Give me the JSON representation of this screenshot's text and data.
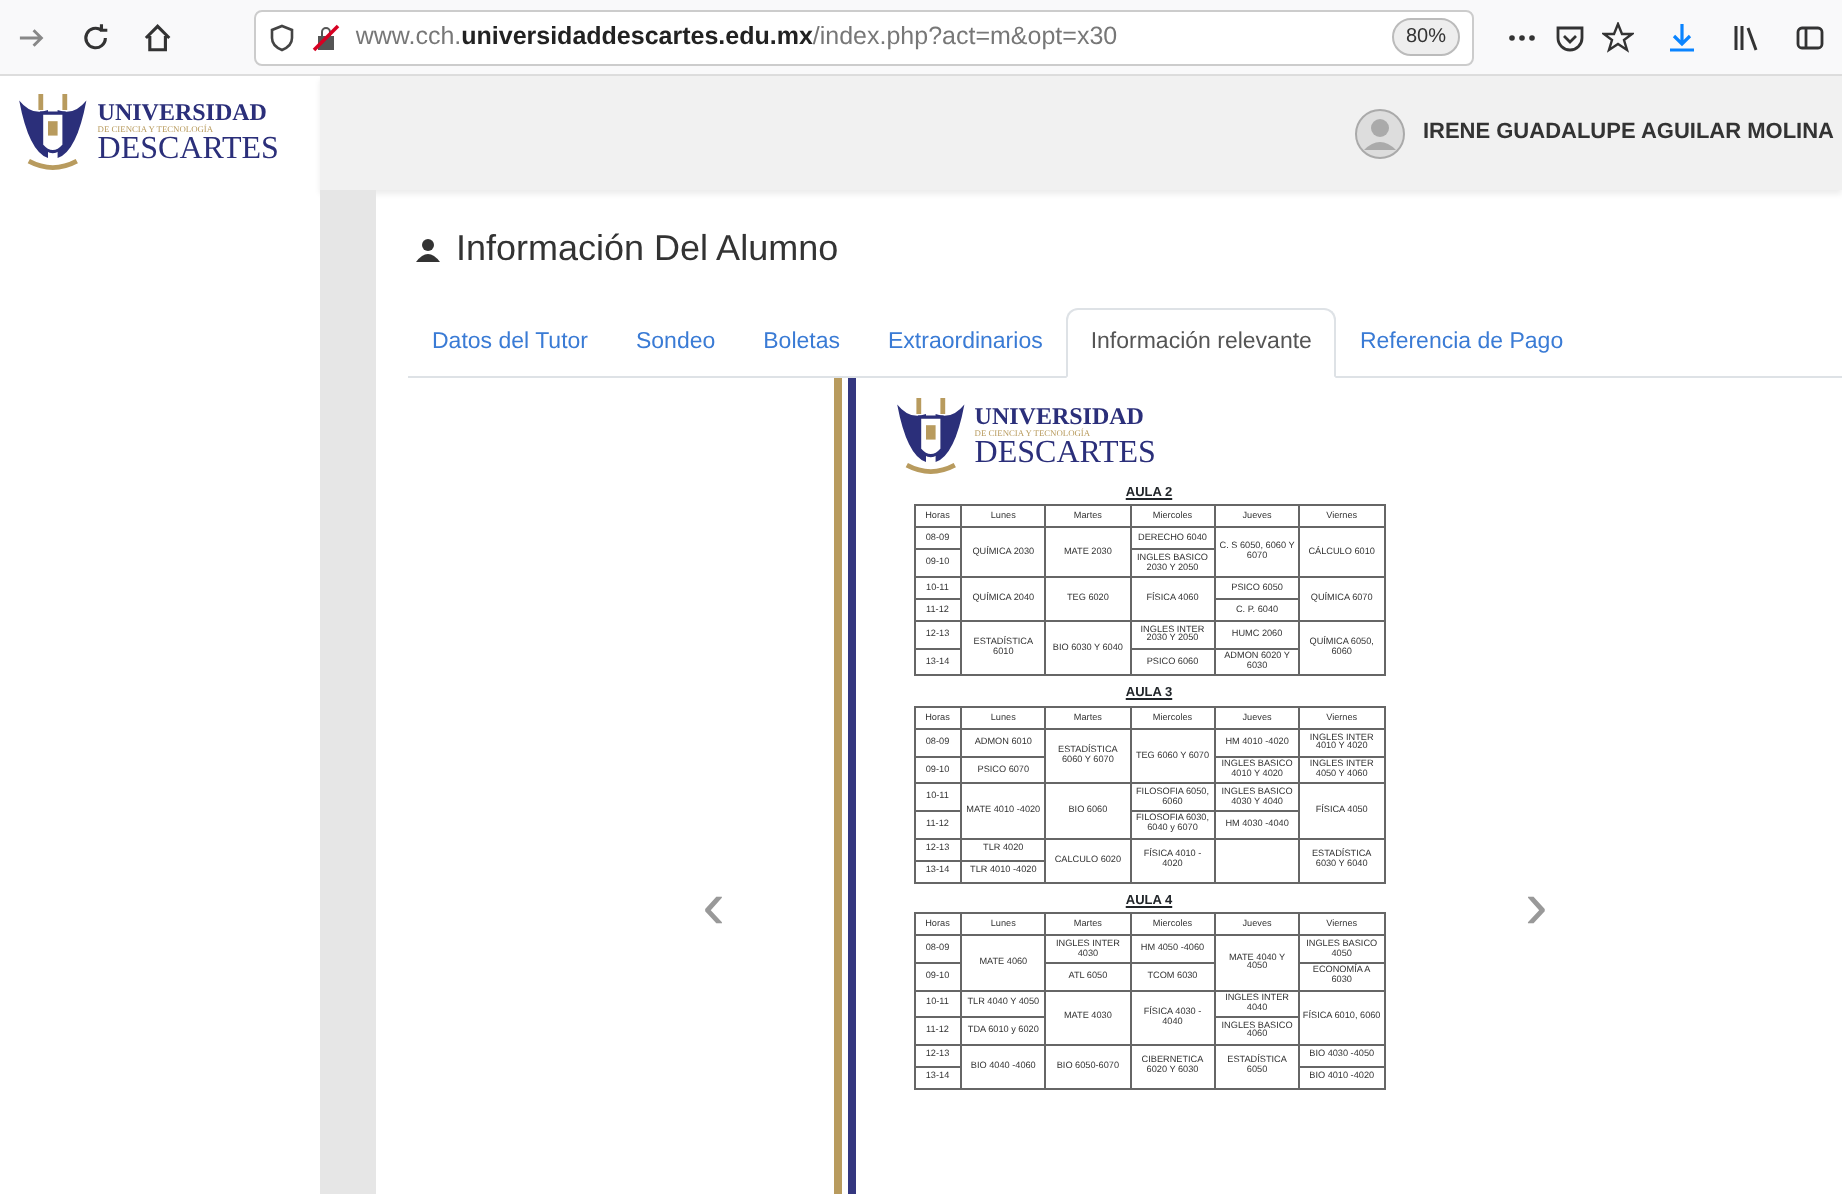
{
  "browser": {
    "url": "www.cch.**universidaddescartes.edu.mx**/index.php?act=m&opt=x30",
    "zoom": "80%"
  },
  "logo": {
    "line1": "UNIVERSIDAD",
    "line2": "DE CIENCIA Y TECNOLOGÍA",
    "line3": "DESCARTES"
  },
  "user": {
    "name": "IRENE GUADALUPE AGUILAR MOLINA"
  },
  "page_title": "Información Del Alumno",
  "tabs": [
    {
      "label": "Datos del Tutor",
      "selected": false
    },
    {
      "label": "Sondeo",
      "selected": false
    },
    {
      "label": "Boletas",
      "selected": false
    },
    {
      "label": "Extraordinarios",
      "selected": false
    },
    {
      "label": "Información relevante",
      "selected": true
    },
    {
      "label": "Referencia de Pago",
      "selected": false
    }
  ],
  "carousel": {
    "prev": "‹",
    "next": "›"
  },
  "document": {
    "logo": {
      "line1": "UNIVERSIDAD",
      "line2": "DE CIENCIA Y TECNOLOGÍA",
      "line3": "DESCARTES"
    },
    "schedules": [
      {
        "title": "AULA 2",
        "columns": [
          "Horas",
          "Lunes",
          "Martes",
          "Miercoles",
          "Jueves",
          "Viernes"
        ],
        "rows": [
          {
            "cells": [
              {
                "text": "08-09"
              },
              {
                "text": "QUÍMICA 2030",
                "rowspan": 2
              },
              {
                "text": "MATE 2030",
                "rowspan": 2
              },
              {
                "text": "DERECHO 6040"
              },
              {
                "text": "C. S 6050, 6060 Y 6070",
                "rowspan": 2
              },
              {
                "text": "CÁLCULO 6010",
                "rowspan": 2
              }
            ]
          },
          {
            "cells": [
              {
                "text": "09-10"
              },
              {
                "text": "INGLES BASICO 2030 Y 2050"
              }
            ]
          },
          {
            "cells": [
              {
                "text": "10-11"
              },
              {
                "text": "QUÍMICA 2040",
                "rowspan": 2
              },
              {
                "text": "TEG 6020",
                "rowspan": 2
              },
              {
                "text": "FÍSICA 4060",
                "rowspan": 2
              },
              {
                "text": "PSICO 6050"
              },
              {
                "text": "QUÍMICA 6070",
                "rowspan": 2
              }
            ]
          },
          {
            "cells": [
              {
                "text": "11-12"
              },
              {
                "text": "C. P. 6040"
              }
            ]
          },
          {
            "cells": [
              {
                "text": "12-13"
              },
              {
                "text": "ESTADÍSTICA 6010",
                "rowspan": 2
              },
              {
                "text": "BIO 6030 Y 6040",
                "rowspan": 2
              },
              {
                "text": "INGLES INTER 2030 Y 2050"
              },
              {
                "text": "HUMC 2060"
              },
              {
                "text": "QUÍMICA 6050, 6060",
                "rowspan": 2
              }
            ]
          },
          {
            "cells": [
              {
                "text": "13-14"
              },
              {
                "text": "PSICO 6060"
              },
              {
                "text": "ADMON 6020 Y 6030"
              }
            ]
          }
        ]
      },
      {
        "title": "AULA 3",
        "columns": [
          "Horas",
          "Lunes",
          "Martes",
          "Miercoles",
          "Jueves",
          "Viernes"
        ],
        "rows": [
          {
            "cells": [
              {
                "text": "08-09"
              },
              {
                "text": "ADMON 6010"
              },
              {
                "text": "ESTADÍSTICA 6060 Y 6070",
                "rowspan": 2
              },
              {
                "text": "TEG 6060 Y 6070",
                "rowspan": 2
              },
              {
                "text": "HM 4010 -4020"
              },
              {
                "text": "INGLES INTER 4010 Y 4020"
              }
            ]
          },
          {
            "cells": [
              {
                "text": "09-10"
              },
              {
                "text": "PSICO 6070"
              },
              {
                "text": "INGLES BASICO 4010 Y 4020"
              },
              {
                "text": "INGLES INTER 4050 Y 4060"
              }
            ]
          },
          {
            "cells": [
              {
                "text": "10-11"
              },
              {
                "text": "MATE 4010 -4020",
                "rowspan": 2
              },
              {
                "text": "BIO 6060",
                "rowspan": 2
              },
              {
                "text": "FILOSOFIA 6050, 6060"
              },
              {
                "text": "INGLES BASICO 4030 Y 4040"
              },
              {
                "text": "FÍSICA 4050",
                "rowspan": 2
              }
            ]
          },
          {
            "cells": [
              {
                "text": "11-12"
              },
              {
                "text": "FILOSOFIA 6030, 6040 y 6070"
              },
              {
                "text": "HM 4030 -4040"
              }
            ]
          },
          {
            "cells": [
              {
                "text": "12-13"
              },
              {
                "text": "TLR 4020"
              },
              {
                "text": "CALCULO 6020",
                "rowspan": 2
              },
              {
                "text": "FÍSICA 4010 - 4020",
                "rowspan": 2
              },
              {
                "rowspan": 2
              },
              {
                "text": "ESTADÍSTICA 6030 Y 6040",
                "rowspan": 2
              }
            ]
          },
          {
            "cells": [
              {
                "text": "13-14"
              },
              {
                "text": "TLR 4010 -4020"
              }
            ]
          }
        ]
      },
      {
        "title": "AULA 4",
        "columns": [
          "Horas",
          "Lunes",
          "Martes",
          "Miercoles",
          "Jueves",
          "Viernes"
        ],
        "rows": [
          {
            "cells": [
              {
                "text": "08-09"
              },
              {
                "text": "MATE 4060",
                "rowspan": 2
              },
              {
                "text": "INGLES INTER 4030"
              },
              {
                "text": "HM 4050 -4060"
              },
              {
                "text": "MATE 4040 Y 4050",
                "rowspan": 2
              },
              {
                "text": "INGLES BASICO 4050"
              }
            ]
          },
          {
            "cells": [
              {
                "text": "09-10"
              },
              {
                "text": "ATL 6050"
              },
              {
                "text": "TCOM 6030"
              },
              {
                "text": "ECONOMÍA A 6030"
              }
            ]
          },
          {
            "cells": [
              {
                "text": "10-11"
              },
              {
                "text": "TLR 4040 Y 4050"
              },
              {
                "text": "MATE 4030",
                "rowspan": 2
              },
              {
                "text": "FÍSICA 4030 - 4040",
                "rowspan": 2
              },
              {
                "text": "INGLES INTER 4040"
              },
              {
                "text": "FÍSICA 6010, 6060",
                "rowspan": 2
              }
            ]
          },
          {
            "cells": [
              {
                "text": "11-12"
              },
              {
                "text": "TDA 6010 y 6020"
              },
              {
                "text": "INGLES BASICO 4060"
              }
            ]
          },
          {
            "cells": [
              {
                "text": "12-13"
              },
              {
                "text": "BIO 4040 -4060",
                "rowspan": 2
              },
              {
                "text": "BIO 6050-6070",
                "rowspan": 2
              },
              {
                "text": "CIBERNETICA 6020 Y 6030",
                "rowspan": 2
              },
              {
                "text": "ESTADÍSTICA 6050",
                "rowspan": 2
              },
              {
                "text": "BIO 4030 -4050"
              }
            ]
          },
          {
            "cells": [
              {
                "text": "13-14"
              },
              {
                "text": "BIO 4010 -4020"
              }
            ]
          }
        ]
      }
    ]
  }
}
